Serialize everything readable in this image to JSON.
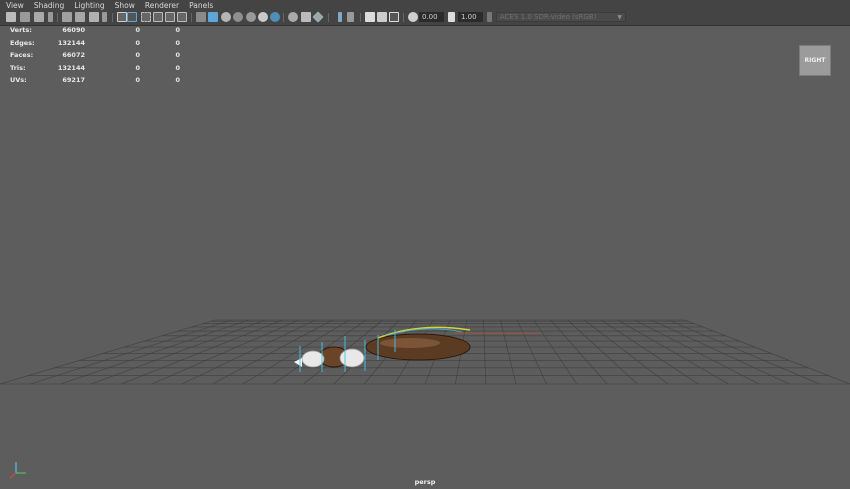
{
  "menu": [
    "View",
    "Shading",
    "Lighting",
    "Show",
    "Renderer",
    "Panels"
  ],
  "toolbar": {
    "exposure": "0.00",
    "gamma": "1.00",
    "color_space": "ACES 1.0 SDR-video (sRGB)"
  },
  "hud": {
    "rows": [
      {
        "label": "Verts:",
        "v1": "66090",
        "v2": "0",
        "v3": "0"
      },
      {
        "label": "Edges:",
        "v1": "132144",
        "v2": "0",
        "v3": "0"
      },
      {
        "label": "Faces:",
        "v1": "66072",
        "v2": "0",
        "v3": "0"
      },
      {
        "label": "Tris:",
        "v1": "132144",
        "v2": "0",
        "v3": "0"
      },
      {
        "label": "UVs:",
        "v1": "69217",
        "v2": "0",
        "v3": "0"
      }
    ]
  },
  "viewcube": {
    "label": "RIGHT"
  },
  "camera": {
    "label": "persp"
  },
  "colors": {
    "viewport_bg": "#5d5d5d",
    "grid": "#3f3f3f",
    "active_icon": "#5aa7d8"
  }
}
